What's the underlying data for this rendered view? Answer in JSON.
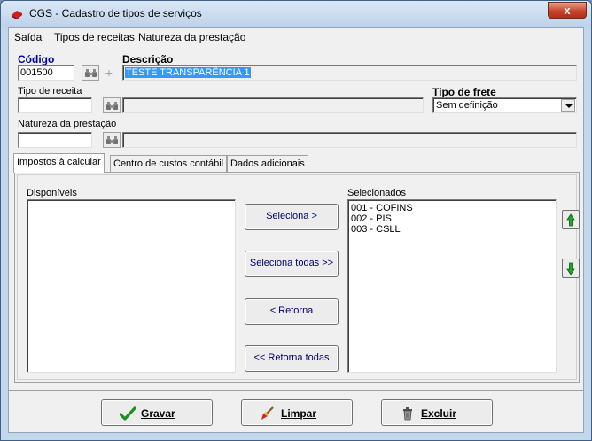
{
  "window": {
    "title": "CGS - Cadastro de tipos de serviços",
    "close_label": "x"
  },
  "menu": [
    "Saída",
    "Tipos de receitas",
    "Natureza da prestação"
  ],
  "fields": {
    "codigo_label": "Código",
    "codigo_value": "001500",
    "descricao_label": "Descrição",
    "descricao_value": "TESTE TRANSPARÊNCIA 1",
    "tipo_receita_label": "Tipo de receita",
    "tipo_receita_value": "",
    "tipo_receita_desc": "",
    "tipo_frete_label": "Tipo de frete",
    "tipo_frete_value": "Sem definição",
    "natureza_label": "Natureza da prestação",
    "natureza_value": "",
    "natureza_desc": ""
  },
  "tabs": [
    "Impostos à calcular",
    "Centro de custos contábil",
    "Dados adicionais"
  ],
  "active_tab": 0,
  "impostos": {
    "disponiveis_label": "Disponíveis",
    "disponiveis": [],
    "selecionados_label": "Selecionados",
    "selecionados": [
      "001 - COFINS",
      "002 - PIS",
      "003 - CSLL"
    ],
    "btn_seleciona": "Seleciona >",
    "btn_seleciona_todas": "Seleciona todas >>",
    "btn_retorna": "< Retorna",
    "btn_retorna_todas": "<< Retorna todas"
  },
  "actions": {
    "gravar": "Gravar",
    "limpar": "Limpar",
    "excluir": "Excluir"
  },
  "colors": {
    "label_accent": "#0000a0",
    "selection": "#3399ff",
    "close_red": "#c8432b",
    "arrow_green": "#22a32a"
  }
}
